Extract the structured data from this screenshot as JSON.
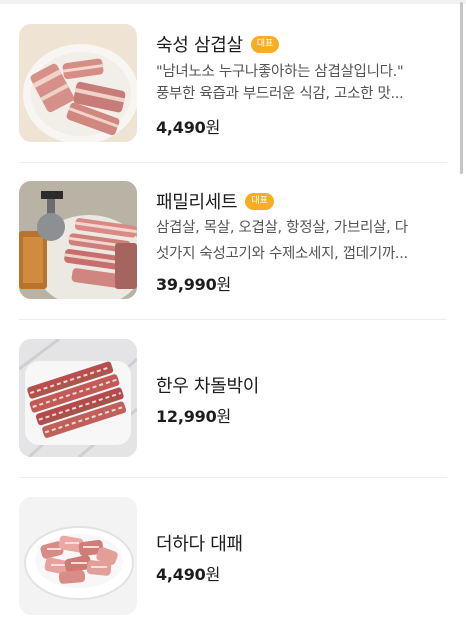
{
  "menu": {
    "items": [
      {
        "name": "숙성 삼겹살",
        "badge": "대표",
        "desc_line1": "\"남녀노소 누구나좋아하는 삼겹살입니다.\"",
        "desc_line2": "풍부한 육즙과 부드러운 식감, 고소한 맛...",
        "price": "4,490",
        "currency": "원",
        "image_icon": "pork-belly-plate-image"
      },
      {
        "name": "패밀리세트",
        "badge": "대표",
        "desc_line1": "삼겹살, 목살, 오겹살, 항정살, 가브리살, 다",
        "desc_line2": "섯가지 숙성고기와 수제소세지, 껍데기까...",
        "price": "39,990",
        "currency": "원",
        "image_icon": "family-set-platter-image"
      },
      {
        "name": "한우 차돌박이",
        "price": "12,990",
        "currency": "원",
        "image_icon": "beef-brisket-plate-image"
      },
      {
        "name": "더하다 대패",
        "price": "4,490",
        "currency": "원",
        "image_icon": "thin-sliced-pork-plate-image"
      }
    ]
  },
  "colors": {
    "badge": "#f6ad22",
    "text": "#1d1d1f",
    "description": "#555555",
    "divider": "#ececee"
  }
}
